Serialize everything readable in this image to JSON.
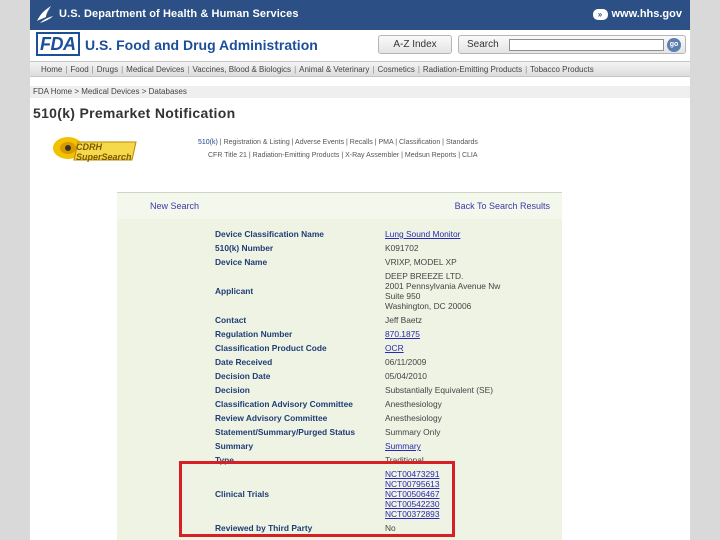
{
  "hhs_bar": {
    "title": "U.S. Department of Health & Human Services",
    "site": "www.hhs.gov"
  },
  "fda_header": {
    "logo_text": "FDA",
    "agency_name": "U.S. Food and Drug Administration",
    "az_index_label": "A-Z Index",
    "search_label": "Search",
    "search_value": "",
    "go_label": "go"
  },
  "nav": {
    "items": [
      "Home",
      "Food",
      "Drugs",
      "Medical Devices",
      "Vaccines, Blood & Biologics",
      "Animal & Veterinary",
      "Cosmetics",
      "Radiation-Emitting Products",
      "Tobacco Products"
    ]
  },
  "breadcrumb": "FDA Home > Medical Devices > Databases",
  "page_title": "510(k) Premarket Notification",
  "cdrh_logo_text": "CDRH SuperSearch",
  "links_row1": [
    "510(k)",
    "Registration & Listing",
    "Adverse Events",
    "Recalls",
    "PMA",
    "Classification",
    "Standards"
  ],
  "links_row2": [
    "CFR Title 21",
    "Radiation-Emitting Products",
    "X-Ray Assembler",
    "Medsun Reports",
    "CLIA"
  ],
  "panel": {
    "new_search": "New Search",
    "back_to_results": "Back To Search Results",
    "rows": [
      {
        "label": "Device Classification Name",
        "value": [
          "Lung Sound Monitor"
        ],
        "link": true
      },
      {
        "label": "510(k) Number",
        "value": [
          "K091702"
        ],
        "link": false
      },
      {
        "label": "Device Name",
        "value": [
          "VRIXP, MODEL XP"
        ],
        "link": false
      },
      {
        "label": "Applicant",
        "value": [
          "DEEP BREEZE LTD.",
          "2001 Pennsylvania Avenue Nw",
          "Suite 950",
          "Washington, DC 20006"
        ],
        "link": false
      },
      {
        "label": "Contact",
        "value": [
          "Jeff Baetz"
        ],
        "link": false
      },
      {
        "label": "Regulation Number",
        "value": [
          "870.1875"
        ],
        "link": true
      },
      {
        "label": "Classification Product Code",
        "value": [
          "OCR"
        ],
        "link": true
      },
      {
        "label": "Date Received",
        "value": [
          "06/11/2009"
        ],
        "link": false
      },
      {
        "label": "Decision Date",
        "value": [
          "05/04/2010"
        ],
        "link": false
      },
      {
        "label": "Decision",
        "value": [
          "Substantially Equivalent (SE)"
        ],
        "link": false
      },
      {
        "label": "Classification Advisory Committee",
        "value": [
          "Anesthesiology"
        ],
        "link": false
      },
      {
        "label": "Review Advisory Committee",
        "value": [
          "Anesthesiology"
        ],
        "link": false
      },
      {
        "label": "Statement/Summary/Purged Status",
        "value": [
          "Summary Only"
        ],
        "link": false
      },
      {
        "label": "Summary",
        "value": [
          "Summary"
        ],
        "link": true
      },
      {
        "label": "Type",
        "value": [
          "Traditional"
        ],
        "link": false
      },
      {
        "label": "Clinical Trials",
        "value": [
          "NCT00473291",
          "NCT00795613",
          "NCT00506467",
          "NCT00542230",
          "NCT00372893"
        ],
        "link": true
      },
      {
        "label": "Reviewed by Third Party",
        "value": [
          "No"
        ],
        "link": false
      }
    ]
  },
  "colors": {
    "hhs_blue": "#2c4f86",
    "fda_blue": "#1b4e9b",
    "panel_bg": "#eef3e4",
    "highlight": "#d71f26"
  }
}
